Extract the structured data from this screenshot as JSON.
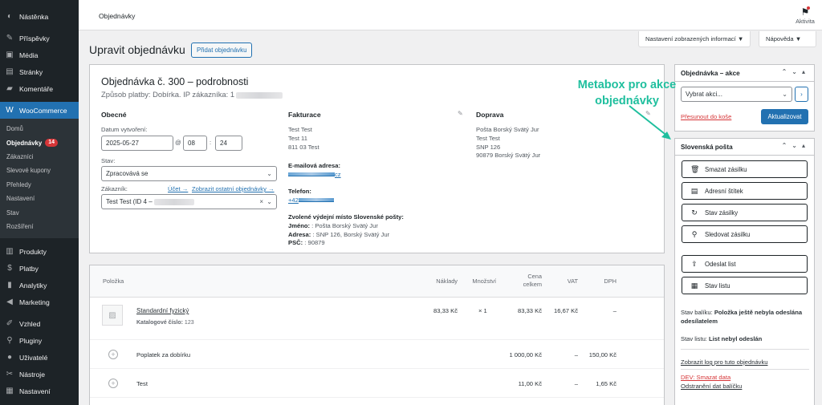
{
  "sidebar": {
    "items": [
      {
        "label": "Nástěnka",
        "icon": "dashboard-icon"
      },
      {
        "label": "Příspěvky",
        "icon": "pin-icon"
      },
      {
        "label": "Média",
        "icon": "media-icon"
      },
      {
        "label": "Stránky",
        "icon": "page-icon"
      },
      {
        "label": "Komentáře",
        "icon": "comment-icon"
      },
      {
        "label": "WooCommerce",
        "icon": "woo-icon"
      }
    ],
    "submenu": [
      "Domů",
      "Objednávky",
      "Zákazníci",
      "Slevové kupony",
      "Přehledy",
      "Nastavení",
      "Stav",
      "Rozšíření"
    ],
    "orders_badge": "14",
    "items_bottom": [
      {
        "label": "Produkty",
        "icon": "products-icon"
      },
      {
        "label": "Platby",
        "icon": "payments-icon"
      },
      {
        "label": "Analytiky",
        "icon": "analytics-icon"
      },
      {
        "label": "Marketing",
        "icon": "marketing-icon"
      },
      {
        "label": "Vzhled",
        "icon": "brush-icon"
      },
      {
        "label": "Pluginy",
        "icon": "plugin-icon"
      },
      {
        "label": "Uživatelé",
        "icon": "users-icon"
      },
      {
        "label": "Nástroje",
        "icon": "tools-icon"
      },
      {
        "label": "Nastavení",
        "icon": "settings-icon"
      }
    ]
  },
  "topbar": {
    "title": "Objednávky",
    "activity": "Aktivita"
  },
  "screen_options": "Nastavení zobrazených informací",
  "help": "Nápověda",
  "heading": "Upravit objednávku",
  "add_order": "Přidat objednávku",
  "order": {
    "title": "Objednávka č. 300 – podrobnosti",
    "subtitle": "Způsob platby: Dobírka. IP zákazníka: 1",
    "general": {
      "heading": "Obecné",
      "created_label": "Datum vytvoření:",
      "date": "2025-05-27",
      "at": "@",
      "hour": "08",
      "colon": ":",
      "minute": "24",
      "status_label": "Stav:",
      "status": "Zpracovává se",
      "customer_label": "Zákazník:",
      "account_link": "Účet →",
      "other_orders_link": "Zobrazit ostatní objednávky →",
      "customer": "Test Test (ID 4 –"
    },
    "billing": {
      "heading": "Fakturace",
      "lines": [
        "Test Test",
        "Test 11",
        "811 03 Test"
      ],
      "email_label": "E-mailová adresa:",
      "email": "cz",
      "phone_label": "Telefon:",
      "phone": "+42",
      "pickup_heading": "Zvolené výdejní místo Slovenské pošty:",
      "name_label": "Jméno:",
      "name_value": ": Pošta Borský Svätý Jur",
      "address_label": "Adresa:",
      "address_value": ": SNP 126, Borský Svätý Jur",
      "zip_label": "PSČ:",
      "zip_value": ": 90879"
    },
    "shipping": {
      "heading": "Doprava",
      "lines": [
        "Pošta Borský Svätý Jur",
        "Test Test",
        "SNP 126",
        "90879 Borský Svätý Jur"
      ]
    }
  },
  "items": {
    "headers": {
      "item": "Položka",
      "cost": "Náklady",
      "qty": "Množství",
      "price_1": "Cena",
      "price_2": "celkem",
      "vat": "VAT",
      "tax": "DPH"
    },
    "product": {
      "name": "Standardní fyzický",
      "sku_label": "Katalogové číslo:",
      "sku": "123",
      "cost": "83,33 Kč",
      "qty": "× 1",
      "total": "83,33 Kč",
      "vat": "16,67 Kč",
      "tax": "–"
    },
    "fees": [
      {
        "name": "Poplatek za dobírku",
        "total": "1 000,00 Kč",
        "vat": "–",
        "tax": "150,00 Kč"
      },
      {
        "name": "Test",
        "total": "11,00 Kč",
        "vat": "–",
        "tax": "1,65 Kč"
      }
    ]
  },
  "actions_box": {
    "title": "Objednávka – akce",
    "select": "Vybrat akci...",
    "go": "›",
    "trash": "Přesunout do koše",
    "update": "Aktualizovat"
  },
  "sk_box": {
    "title": "Slovenská pošta",
    "buttons": [
      {
        "label": "Smazat zásilku",
        "icon": "trash-icon"
      },
      {
        "label": "Adresní štítek",
        "icon": "label-icon"
      },
      {
        "label": "Stav zásilky",
        "icon": "refresh-icon"
      },
      {
        "label": "Sledovat zásilku",
        "icon": "search-icon"
      },
      {
        "label": "Odeslat list",
        "icon": "upload-icon"
      },
      {
        "label": "Stav listu",
        "icon": "sheet-icon"
      }
    ],
    "package_status_label": "Stav balíku:",
    "package_status": "Položka ještě nebyla odeslána odesílatelem",
    "sheet_status_label": "Stav listu:",
    "sheet_status": "List nebyl odeslán",
    "log_link": "Zobrazit log pro tuto objednávku",
    "dev_link": "DEV: Smazat data",
    "remove_link": "Odstranění dat balíčku"
  },
  "annotation": {
    "line1": "Metabox pro akce",
    "line2": "objednávky",
    "color": "#1fbf9e"
  }
}
